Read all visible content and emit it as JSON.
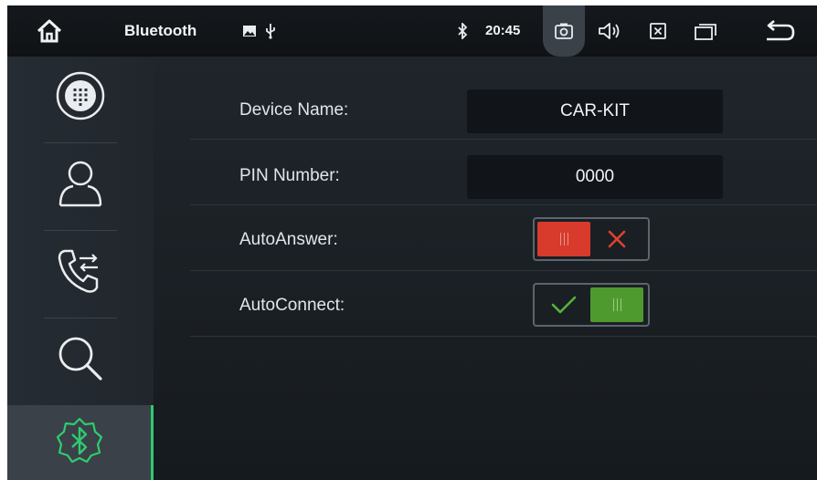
{
  "status_bar": {
    "title": "Bluetooth",
    "time": "20:45",
    "icons": [
      "home-icon",
      "image-icon",
      "usb-icon",
      "bluetooth-status-icon",
      "camera-icon",
      "volume-icon",
      "close-app-icon",
      "recent-apps-icon",
      "back-icon"
    ]
  },
  "sidebar": {
    "items": [
      {
        "name": "dialpad",
        "icon": "dialpad-icon",
        "active": false
      },
      {
        "name": "contacts",
        "icon": "contact-icon",
        "active": false
      },
      {
        "name": "call-log",
        "icon": "call-transfer-icon",
        "active": false
      },
      {
        "name": "search",
        "icon": "search-icon",
        "active": false
      },
      {
        "name": "bluetooth-settings",
        "icon": "bluetooth-icon",
        "active": true
      }
    ]
  },
  "settings": {
    "device_name": {
      "label": "Device Name:",
      "value": "CAR-KIT"
    },
    "pin_number": {
      "label": "PIN Number:",
      "value": "0000"
    },
    "auto_answer": {
      "label": "AutoAnswer:",
      "state": "off"
    },
    "auto_connect": {
      "label": "AutoConnect:",
      "state": "on"
    }
  },
  "colors": {
    "toggle_off": "#d83a2c",
    "toggle_on": "#4f9a2f",
    "active_accent": "#2ecc71"
  }
}
